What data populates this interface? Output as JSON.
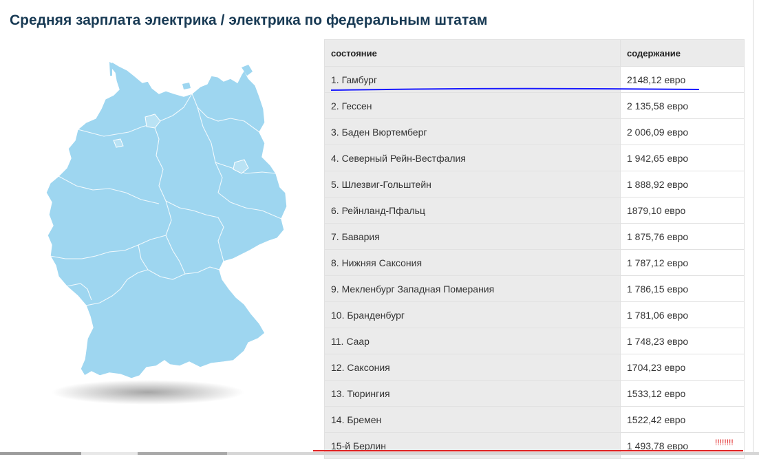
{
  "title": "Средняя зарплата электрика / электрика по федеральным штатам",
  "table": {
    "headers": {
      "state": "состояние",
      "salary": "содержание"
    },
    "rows": [
      {
        "state": "1. Гамбург",
        "salary": "2148,12 евро"
      },
      {
        "state": "2. Гессен",
        "salary": "2 135,58 евро"
      },
      {
        "state": "3. Баден Вюртемберг",
        "salary": "2 006,09 евро"
      },
      {
        "state": "4. Северный Рейн-Вестфалия",
        "salary": "1 942,65 евро"
      },
      {
        "state": "5. Шлезвиг-Гольштейн",
        "salary": "1 888,92 евро"
      },
      {
        "state": "6. Рейнланд-Пфальц",
        "salary": "1879,10 евро"
      },
      {
        "state": "7. Бавария",
        "salary": "1 875,76 евро"
      },
      {
        "state": "8. Нижняя Саксония",
        "salary": "1 787,12 евро"
      },
      {
        "state": "9. Мекленбург Западная Померания",
        "salary": "1 786,15 евро"
      },
      {
        "state": "10. Бранденбург",
        "salary": "1 781,06 евро"
      },
      {
        "state": "11. Саар",
        "salary": "1 748,23 евро"
      },
      {
        "state": "12. Саксония",
        "salary": "1704,23 евро"
      },
      {
        "state": "13. Тюрингия",
        "salary": "1533,12 евро"
      },
      {
        "state": "14. Бремен",
        "salary": "1522,42 евро"
      },
      {
        "state": "15-й Берлин",
        "salary": "1 493,78 евро"
      }
    ]
  },
  "annotation_text": "!!!!!!!!",
  "colors": {
    "map_fill": "#9ed6f0",
    "map_border": "#ffffff",
    "title": "#183a54",
    "blue_annotation": "#1a1aff",
    "red_annotation": "#e02020"
  }
}
